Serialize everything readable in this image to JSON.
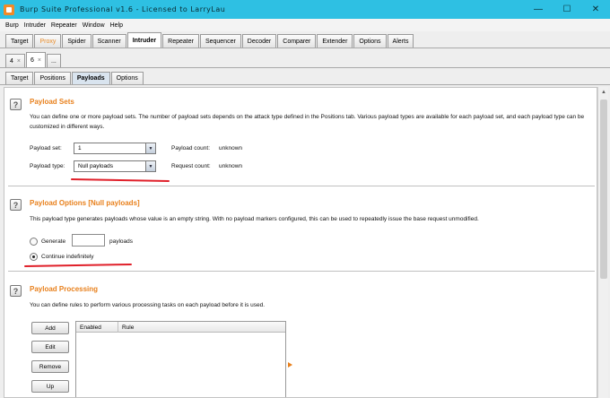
{
  "window": {
    "title": "Burp Suite Professional v1.6 - Licensed to LarryLau",
    "minimize": "—",
    "maximize": "☐",
    "close": "✕"
  },
  "menu": [
    "Burp",
    "Intruder",
    "Repeater",
    "Window",
    "Help"
  ],
  "main_tabs": [
    "Target",
    "Proxy",
    "Spider",
    "Scanner",
    "Intruder",
    "Repeater",
    "Sequencer",
    "Decoder",
    "Comparer",
    "Extender",
    "Options",
    "Alerts"
  ],
  "sub_tabs": {
    "tab1": "4",
    "tab2": "6",
    "more": "..."
  },
  "inner_tabs": [
    "Target",
    "Positions",
    "Payloads",
    "Options"
  ],
  "payload_sets": {
    "title": "Payload Sets",
    "description": "You can define one or more payload sets. The number of payload sets depends on the attack type defined in the Positions tab. Various payload types are available for each payload set, and each payload type can be customized in different ways.",
    "set_label": "Payload set:",
    "set_value": "1",
    "count_label": "Payload count:",
    "count_value": "unknown",
    "type_label": "Payload type:",
    "type_value": "Null payloads",
    "request_label": "Request count:",
    "request_value": "unknown"
  },
  "payload_options": {
    "title": "Payload Options [Null payloads]",
    "description": "This payload type generates payloads whose value is an empty string. With no payload markers configured, this can be used to repeatedly issue the base request unmodified.",
    "generate_label": "Generate",
    "generate_value": "",
    "payloads_label": "payloads",
    "continue_label": "Continue indefinitely",
    "selected": "continue"
  },
  "payload_processing": {
    "title": "Payload Processing",
    "description": "You can define rules to perform various processing tasks on each payload before it is used.",
    "buttons": [
      "Add",
      "Edit",
      "Remove",
      "Up"
    ],
    "columns": [
      "Enabled",
      "Rule"
    ]
  },
  "colors": {
    "titlebar": "#2ec0e3",
    "accent": "#e8801c",
    "annotation": "#e0202a"
  },
  "help_glyph": "?"
}
